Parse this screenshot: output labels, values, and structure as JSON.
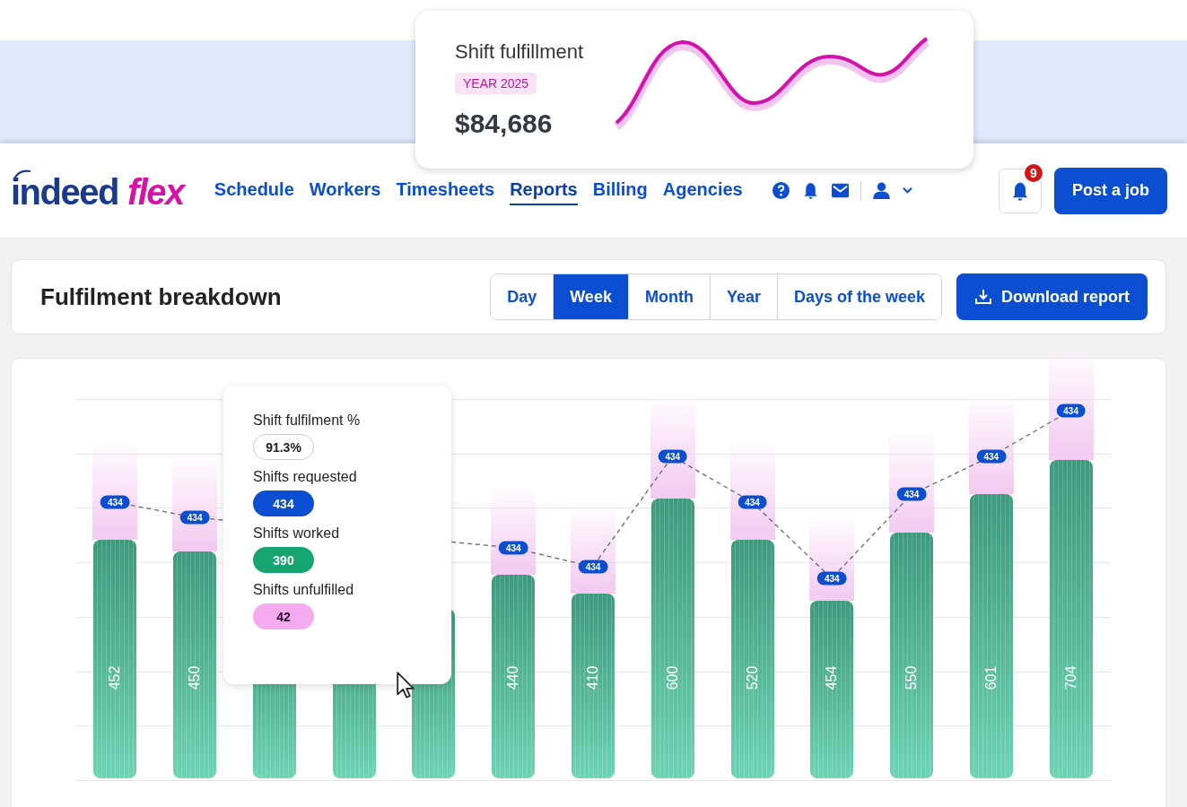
{
  "summary_card": {
    "title": "Shift fulfillment",
    "badge": "YEAR 2025",
    "amount": "$84,686"
  },
  "logo": {
    "name": "indeed",
    "suffix": "flex"
  },
  "nav": [
    {
      "label": "Schedule",
      "selected": false
    },
    {
      "label": "Workers",
      "selected": false
    },
    {
      "label": "Timesheets",
      "selected": false
    },
    {
      "label": "Reports",
      "selected": true
    },
    {
      "label": "Billing",
      "selected": false
    },
    {
      "label": "Agencies",
      "selected": false
    }
  ],
  "notifications": {
    "count": "9"
  },
  "post_button": "Post a job",
  "header": {
    "title": "Fulfilment breakdown",
    "download": "Download report"
  },
  "periods": [
    {
      "label": "Day",
      "selected": false
    },
    {
      "label": "Week",
      "selected": true
    },
    {
      "label": "Month",
      "selected": false
    },
    {
      "label": "Year",
      "selected": false
    },
    {
      "label": "Days of the week",
      "selected": false
    }
  ],
  "bars_left": [
    {
      "value": "452",
      "marker": "434"
    },
    {
      "value": "450",
      "marker": "434"
    }
  ],
  "bars_right": [
    {
      "value": "440",
      "marker": "434"
    },
    {
      "value": "410",
      "marker": "434"
    },
    {
      "value": "600",
      "marker": "434"
    },
    {
      "value": "520",
      "marker": "434"
    },
    {
      "value": "454",
      "marker": "434"
    },
    {
      "value": "550",
      "marker": "434"
    },
    {
      "value": "601",
      "marker": "434"
    },
    {
      "value": "704",
      "marker": "434"
    }
  ],
  "tooltip": [
    {
      "label": "Shift fulfilment %",
      "value": "91.3%",
      "kind": "outline"
    },
    {
      "label": "Shifts requested",
      "value": "434",
      "kind": "blue"
    },
    {
      "label": "Shifts worked",
      "value": "390",
      "kind": "green"
    },
    {
      "label": "Shifts unfulfilled",
      "value": "42",
      "kind": "pink"
    }
  ]
}
